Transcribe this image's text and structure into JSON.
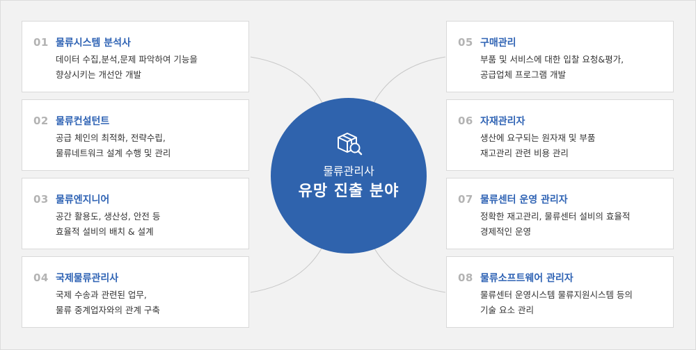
{
  "hub": {
    "subtitle": "물류관리사",
    "title": "유망 진출 분야",
    "icon": "box-search-icon"
  },
  "left_cards": [
    {
      "num": "01",
      "title": "물류시스템 분석사",
      "line1": "데이터 수집,분석,문제 파악하여 기능을",
      "line2": "향상시키는 개선안 개발"
    },
    {
      "num": "02",
      "title": "물류컨설턴트",
      "line1": "공급 체인의 최적화, 전략수립,",
      "line2": "물류네트워크 설계 수행 및 관리"
    },
    {
      "num": "03",
      "title": "물류엔지니어",
      "line1": "공간 활용도, 생산성, 안전 등",
      "line2": "효율적 설비의 배치 & 설계"
    },
    {
      "num": "04",
      "title": "국제물류관리사",
      "line1": "국제 수송과 관련된 업무,",
      "line2": "물류 중계업자와의 관계 구축"
    }
  ],
  "right_cards": [
    {
      "num": "05",
      "title": "구매관리",
      "line1": "부품 및 서비스에 대한 입찰 요청&평가,",
      "line2": "공급업체 프로그램 개발"
    },
    {
      "num": "06",
      "title": "자재관리자",
      "line1": "생산에 요구되는 원자재 및 부품",
      "line2": "재고관리 관련 비용 관리"
    },
    {
      "num": "07",
      "title": "물류센터 운영 관리자",
      "line1": "정확한 재고관리, 물류센터 설비의 효율적",
      "line2": "경제적인 운영"
    },
    {
      "num": "08",
      "title": "물류소프트웨어 관리자",
      "line1": "물류센터 운영시스템 물류지원시스템 등의",
      "line2": "기술 요소 관리"
    }
  ],
  "colors": {
    "accent": "#2f63ad",
    "title_blue": "#2f63b4",
    "number_gray": "#b3b3b3",
    "background": "#f2f2f2"
  }
}
